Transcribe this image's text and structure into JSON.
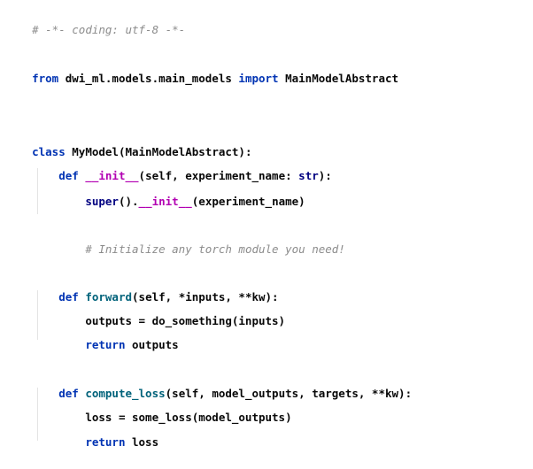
{
  "code": {
    "l1_comment": "# -*- coding: utf-8 -*-",
    "l3_from": "from",
    "l3_module": " dwi_ml.models.main_models ",
    "l3_import": "import",
    "l3_name": " MainModelAbstract",
    "l6_class": "class",
    "l6_rest": " MyModel(MainModelAbstract):",
    "l7_indent": "    ",
    "l7_def": "def",
    "l7_sp": " ",
    "l7_name": "__init__",
    "l7_args": "(self, experiment_name: ",
    "l7_type": "str",
    "l7_end": "):",
    "l8_indent": "        ",
    "l8_super": "super",
    "l8_mid": "().",
    "l8_dunder": "__init__",
    "l8_end": "(experiment_name)",
    "l10_indent": "        ",
    "l10_comment": "# Initialize any torch module you need!",
    "l12_indent": "    ",
    "l12_def": "def",
    "l12_sp": " ",
    "l12_name": "forward",
    "l12_args": "(self, *inputs, **kw):",
    "l13_text": "        outputs = do_something(inputs)",
    "l14_indent": "        ",
    "l14_return": "return",
    "l14_rest": " outputs",
    "l16_indent": "    ",
    "l16_def": "def",
    "l16_sp": " ",
    "l16_name": "compute_loss",
    "l16_args": "(self, model_outputs, targets, **kw):",
    "l17_text": "        loss = some_loss(model_outputs)",
    "l18_indent": "        ",
    "l18_return": "return",
    "l18_rest": " loss"
  }
}
